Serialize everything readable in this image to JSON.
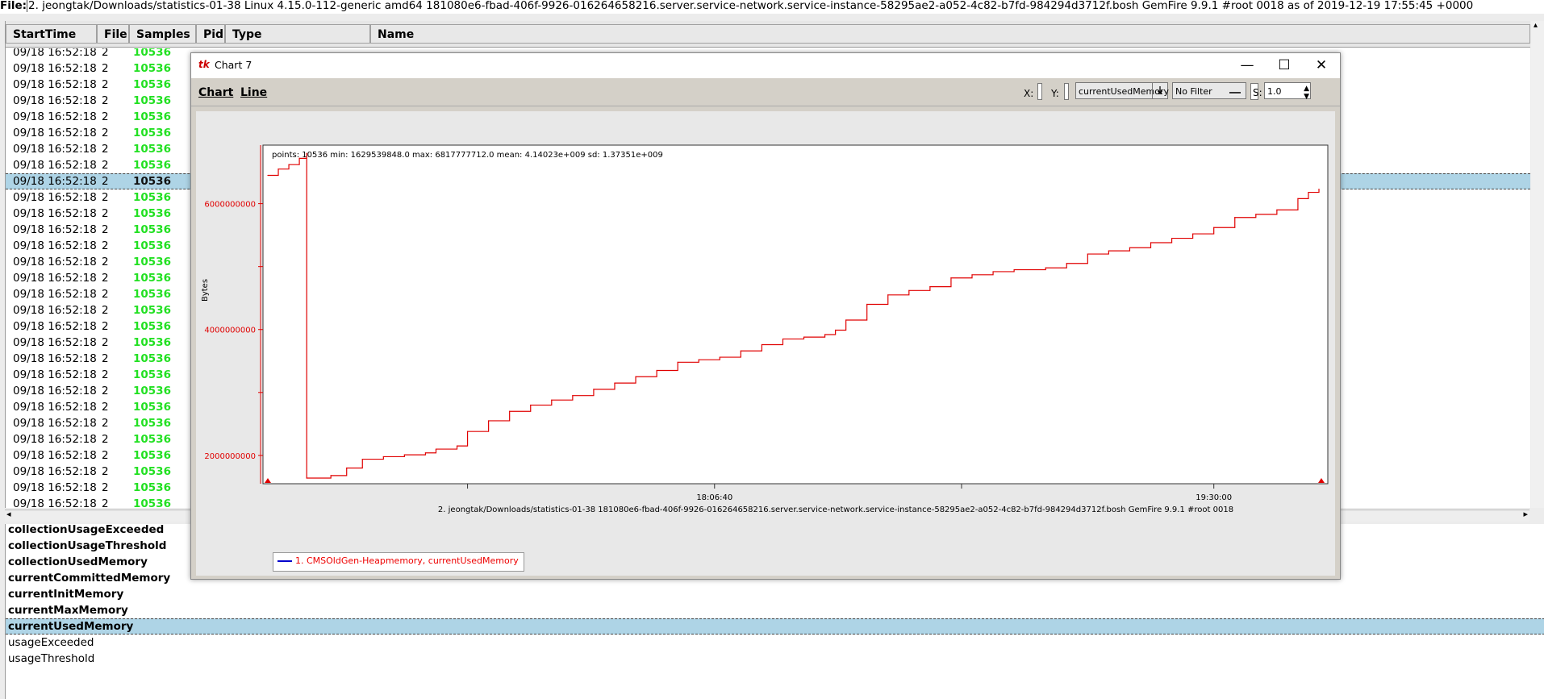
{
  "filebar": {
    "label": "File:",
    "path": "2. jeongtak/Downloads/statistics-01-38 Linux 4.15.0-112-generic amd64 181080e6-fbad-406f-9926-016264658216.server.service-network.service-instance-58295ae2-a052-4c82-b7fd-984294d3712f.bosh GemFire 9.9.1 #root 0018 as of 2019-12-19 17:55:45 +0000"
  },
  "table": {
    "columns": [
      "StartTime",
      "File",
      "Samples",
      "Pid",
      "Type",
      "Name"
    ],
    "rows": [
      [
        "09/18 16:52:18",
        "2",
        "10536"
      ],
      [
        "09/18 16:52:18",
        "2",
        "10536"
      ],
      [
        "09/18 16:52:18",
        "2",
        "10536"
      ],
      [
        "09/18 16:52:18",
        "2",
        "10536"
      ],
      [
        "09/18 16:52:18",
        "2",
        "10536"
      ],
      [
        "09/18 16:52:18",
        "2",
        "10536"
      ],
      [
        "09/18 16:52:18",
        "2",
        "10536"
      ],
      [
        "09/18 16:52:18",
        "2",
        "10536"
      ],
      [
        "09/18 16:52:18",
        "2",
        "10536"
      ],
      [
        "09/18 16:52:18",
        "2",
        "10536"
      ],
      [
        "09/18 16:52:18",
        "2",
        "10536"
      ],
      [
        "09/18 16:52:18",
        "2",
        "10536"
      ],
      [
        "09/18 16:52:18",
        "2",
        "10536"
      ],
      [
        "09/18 16:52:18",
        "2",
        "10536"
      ],
      [
        "09/18 16:52:18",
        "2",
        "10536"
      ],
      [
        "09/18 16:52:18",
        "2",
        "10536"
      ],
      [
        "09/18 16:52:18",
        "2",
        "10536"
      ],
      [
        "09/18 16:52:18",
        "2",
        "10536"
      ],
      [
        "09/18 16:52:18",
        "2",
        "10536"
      ],
      [
        "09/18 16:52:18",
        "2",
        "10536"
      ],
      [
        "09/18 16:52:18",
        "2",
        "10536"
      ],
      [
        "09/18 16:52:18",
        "2",
        "10536"
      ],
      [
        "09/18 16:52:18",
        "2",
        "10536"
      ],
      [
        "09/18 16:52:18",
        "2",
        "10536"
      ],
      [
        "09/18 16:52:18",
        "2",
        "10536"
      ],
      [
        "09/18 16:52:18",
        "2",
        "10536"
      ],
      [
        "09/18 16:52:18",
        "2",
        "10536"
      ],
      [
        "09/18 16:52:18",
        "2",
        "10536"
      ],
      [
        "09/18 16:52:18",
        "2",
        "10536"
      ]
    ],
    "selected_row": 8
  },
  "stats": {
    "items": [
      {
        "label": "collectionUsageExceeded",
        "bold": true
      },
      {
        "label": "collectionUsageThreshold",
        "bold": true
      },
      {
        "label": "collectionUsedMemory",
        "bold": true
      },
      {
        "label": "currentCommittedMemory",
        "bold": true
      },
      {
        "label": "currentInitMemory",
        "bold": true
      },
      {
        "label": "currentMaxMemory",
        "bold": true
      },
      {
        "label": "currentUsedMemory",
        "bold": true,
        "selected": true
      },
      {
        "label": "usageExceeded",
        "bold": false
      },
      {
        "label": "usageThreshold",
        "bold": false
      }
    ]
  },
  "chart_window": {
    "tk_icon": "tk",
    "title": "Chart 7",
    "menu": {
      "chart": "Chart",
      "line": "Line"
    },
    "x_label": "X:",
    "y_label": "Y:",
    "y_combo": "currentUsedMemory",
    "filter": "No Filter",
    "s_label": "S:",
    "s_value": "1.0",
    "minimize": "—",
    "maximize": "☐",
    "close": "✕"
  },
  "chart_data": {
    "type": "line",
    "stats_text": "points: 10536 min: 1629539848.0 max: 6817777712.0 mean: 4.14023e+009 sd: 1.37351e+009",
    "ylabel": "Bytes",
    "y_ticks": [
      2000000000,
      4000000000,
      6000000000
    ],
    "y_tick_labels": [
      "2000000000",
      "4000000000",
      "6000000000"
    ],
    "ylim": [
      1550000000,
      6930000000
    ],
    "x_tick_labels": [
      "18:06:40",
      "19:30:00"
    ],
    "xlabel": "2. jeongtak/Downloads/statistics-01-38 181080e6-fbad-406f-9926-016264658216.server.service-network.service-instance-58295ae2-a052-4c82-b7fd-984294d3712f.bosh GemFire 9.9.1 #root 0018",
    "series": [
      {
        "name": "1.  CMSOldGen-Heapmemory, currentUsedMemory",
        "color": "#e00000",
        "legend_line_color": "#0000cc",
        "points": [
          [
            0.0,
            6450000000
          ],
          [
            0.01,
            6550000000
          ],
          [
            0.02,
            6620000000
          ],
          [
            0.03,
            6720000000
          ],
          [
            0.037,
            6800000000
          ],
          [
            0.037,
            1640000000
          ],
          [
            0.06,
            1680000000
          ],
          [
            0.075,
            1800000000
          ],
          [
            0.09,
            1940000000
          ],
          [
            0.11,
            1980000000
          ],
          [
            0.13,
            2010000000
          ],
          [
            0.15,
            2040000000
          ],
          [
            0.16,
            2100000000
          ],
          [
            0.18,
            2150000000
          ],
          [
            0.19,
            2380000000
          ],
          [
            0.21,
            2550000000
          ],
          [
            0.23,
            2700000000
          ],
          [
            0.25,
            2800000000
          ],
          [
            0.27,
            2880000000
          ],
          [
            0.29,
            2950000000
          ],
          [
            0.31,
            3050000000
          ],
          [
            0.33,
            3150000000
          ],
          [
            0.35,
            3250000000
          ],
          [
            0.37,
            3350000000
          ],
          [
            0.39,
            3480000000
          ],
          [
            0.41,
            3520000000
          ],
          [
            0.43,
            3560000000
          ],
          [
            0.45,
            3660000000
          ],
          [
            0.47,
            3760000000
          ],
          [
            0.49,
            3850000000
          ],
          [
            0.51,
            3880000000
          ],
          [
            0.53,
            3920000000
          ],
          [
            0.54,
            3990000000
          ],
          [
            0.55,
            4150000000
          ],
          [
            0.57,
            4400000000
          ],
          [
            0.59,
            4550000000
          ],
          [
            0.61,
            4620000000
          ],
          [
            0.63,
            4680000000
          ],
          [
            0.65,
            4820000000
          ],
          [
            0.67,
            4870000000
          ],
          [
            0.69,
            4920000000
          ],
          [
            0.71,
            4950000000
          ],
          [
            0.74,
            4980000000
          ],
          [
            0.76,
            5050000000
          ],
          [
            0.78,
            5200000000
          ],
          [
            0.8,
            5250000000
          ],
          [
            0.82,
            5300000000
          ],
          [
            0.84,
            5380000000
          ],
          [
            0.86,
            5450000000
          ],
          [
            0.88,
            5520000000
          ],
          [
            0.9,
            5620000000
          ],
          [
            0.92,
            5780000000
          ],
          [
            0.94,
            5830000000
          ],
          [
            0.96,
            5900000000
          ],
          [
            0.98,
            6080000000
          ],
          [
            0.99,
            6180000000
          ],
          [
            1.0,
            6230000000
          ]
        ]
      }
    ]
  }
}
